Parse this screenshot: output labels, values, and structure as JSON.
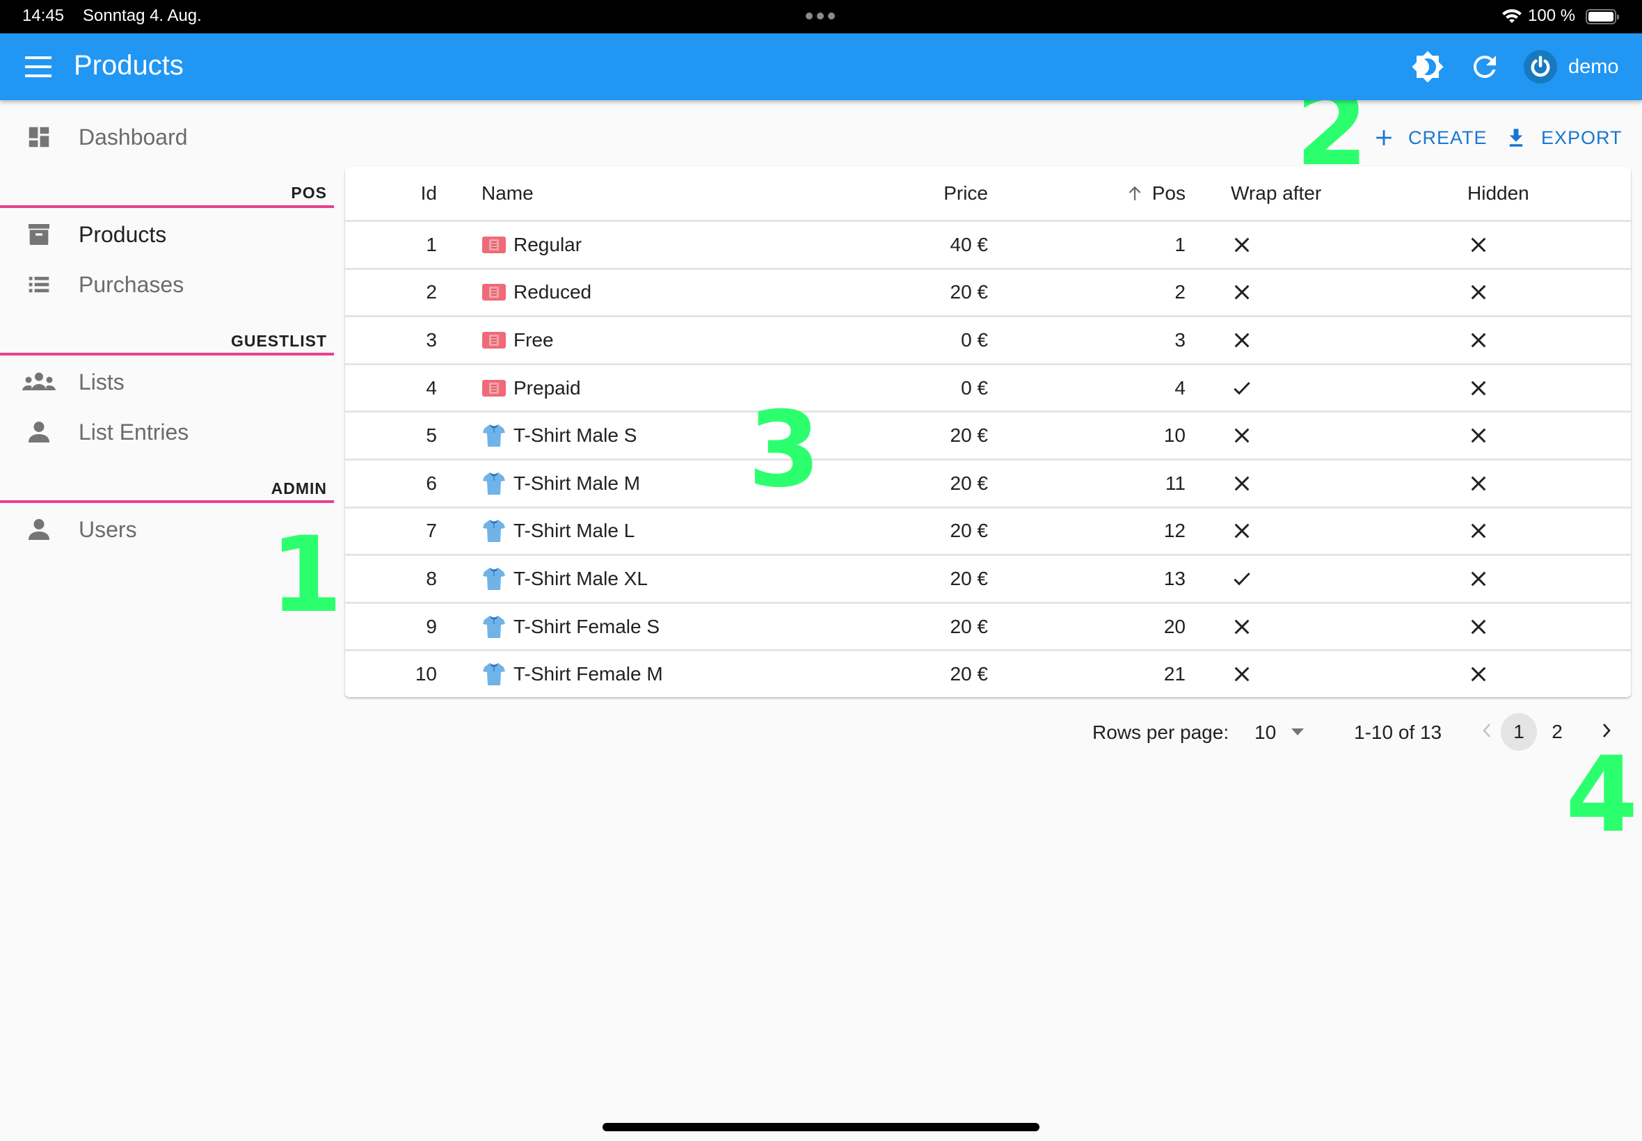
{
  "status_bar": {
    "time": "14:45",
    "date": "Sonntag 4. Aug.",
    "battery_percent": "100 %",
    "icons": [
      "multitasking-dots-icon",
      "wifi-icon",
      "battery-icon"
    ]
  },
  "app_bar": {
    "title": "Products",
    "icons": [
      "menu-icon",
      "theme-toggle-icon",
      "refresh-icon",
      "power-icon"
    ],
    "username": "demo",
    "color": "#2196f3"
  },
  "sidebar": {
    "accent_color": "#e8418e",
    "top_items": [
      {
        "label": "Dashboard",
        "icon": "dashboard-icon"
      }
    ],
    "sections": [
      {
        "title": "POS",
        "items": [
          {
            "label": "Products",
            "icon": "archive-box-icon",
            "active": true
          },
          {
            "label": "Purchases",
            "icon": "list-icon",
            "active": false
          }
        ]
      },
      {
        "title": "GUESTLIST",
        "items": [
          {
            "label": "Lists",
            "icon": "group-icon",
            "active": false
          },
          {
            "label": "List Entries",
            "icon": "person-icon",
            "active": false
          }
        ]
      },
      {
        "title": "ADMIN",
        "items": [
          {
            "label": "Users",
            "icon": "person-icon",
            "active": false
          }
        ]
      }
    ]
  },
  "toolbar": {
    "create_label": "CREATE",
    "export_label": "EXPORT",
    "color": "#1976d2"
  },
  "table": {
    "columns": [
      "Id",
      "Name",
      "Price",
      "Pos",
      "Wrap after",
      "Hidden"
    ],
    "sort": {
      "column": "Pos",
      "direction": "ascending"
    },
    "rows": [
      {
        "id": "1",
        "icon": "ticket",
        "name": "Regular",
        "price": "40 €",
        "pos": "1",
        "wrap_after": false,
        "hidden": false
      },
      {
        "id": "2",
        "icon": "ticket",
        "name": "Reduced",
        "price": "20 €",
        "pos": "2",
        "wrap_after": false,
        "hidden": false
      },
      {
        "id": "3",
        "icon": "ticket",
        "name": "Free",
        "price": "0 €",
        "pos": "3",
        "wrap_after": false,
        "hidden": false
      },
      {
        "id": "4",
        "icon": "ticket",
        "name": "Prepaid",
        "price": "0 €",
        "pos": "4",
        "wrap_after": true,
        "hidden": false
      },
      {
        "id": "5",
        "icon": "tshirt",
        "name": "T-Shirt Male S",
        "price": "20 €",
        "pos": "10",
        "wrap_after": false,
        "hidden": false
      },
      {
        "id": "6",
        "icon": "tshirt",
        "name": "T-Shirt Male M",
        "price": "20 €",
        "pos": "11",
        "wrap_after": false,
        "hidden": false
      },
      {
        "id": "7",
        "icon": "tshirt",
        "name": "T-Shirt Male L",
        "price": "20 €",
        "pos": "12",
        "wrap_after": false,
        "hidden": false
      },
      {
        "id": "8",
        "icon": "tshirt",
        "name": "T-Shirt Male XL",
        "price": "20 €",
        "pos": "13",
        "wrap_after": true,
        "hidden": false
      },
      {
        "id": "9",
        "icon": "tshirt",
        "name": "T-Shirt Female S",
        "price": "20 €",
        "pos": "20",
        "wrap_after": false,
        "hidden": false
      },
      {
        "id": "10",
        "icon": "tshirt",
        "name": "T-Shirt Female M",
        "price": "20 €",
        "pos": "21",
        "wrap_after": false,
        "hidden": false
      }
    ]
  },
  "pagination": {
    "rows_per_page_label": "Rows per page:",
    "rows_per_page": "10",
    "range": "1-10 of 13",
    "pages": [
      "1",
      "2"
    ],
    "current_page": "1"
  },
  "annotations": [
    "1",
    "2",
    "3",
    "4"
  ],
  "annotation_color": "#2cff6e"
}
